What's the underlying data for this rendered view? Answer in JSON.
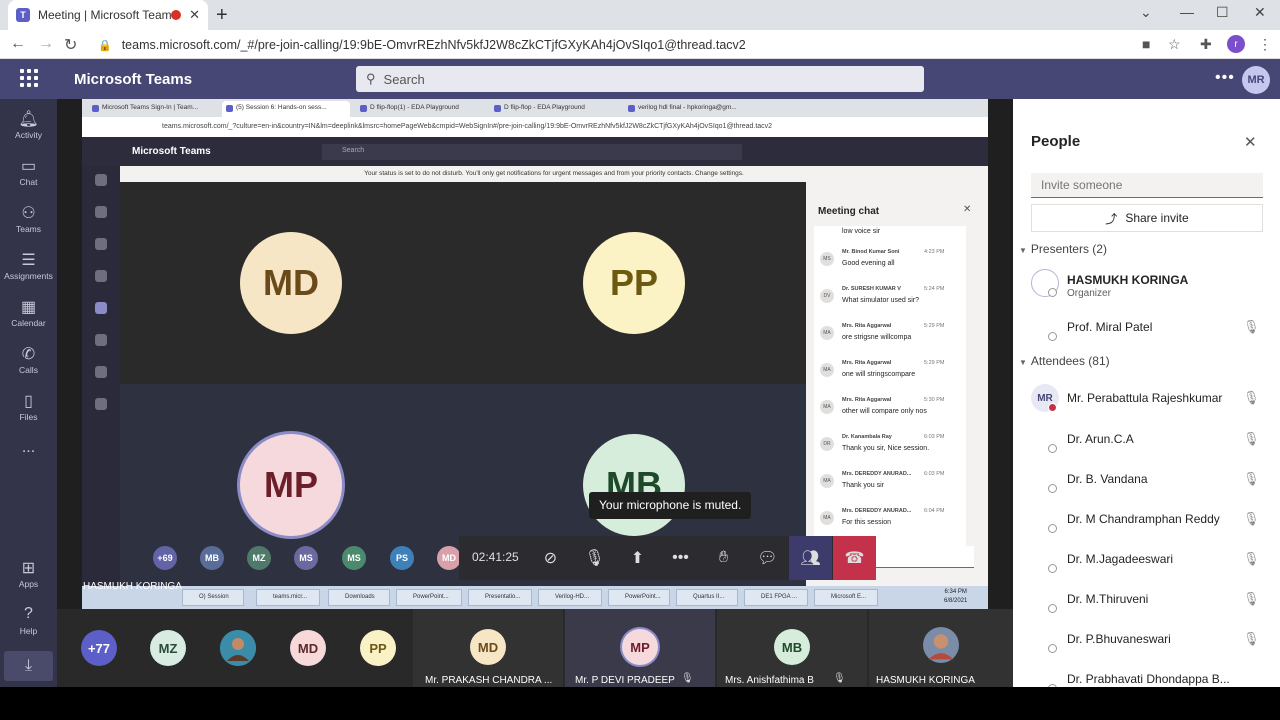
{
  "browser": {
    "tab_title": "Meeting | Microsoft Teams",
    "tab_close": "✕",
    "new_tab": "+",
    "url": "teams.microsoft.com/_#/pre-join-calling/19:9bE-OmvrREzhNfv5kfJ2W8cZkCTjfGXyKAh4jOvSIqo1@thread.tacv2",
    "profile_initial": "r"
  },
  "teams": {
    "app_name": "Microsoft Teams",
    "search_placeholder": "Search",
    "user_initials": "MR"
  },
  "rail": [
    {
      "label": "Activity",
      "icon": "bell-icon"
    },
    {
      "label": "Chat",
      "icon": "chat-icon"
    },
    {
      "label": "Teams",
      "icon": "teams-icon"
    },
    {
      "label": "Assignments",
      "icon": "assignments-icon"
    },
    {
      "label": "Calendar",
      "icon": "calendar-icon"
    },
    {
      "label": "Calls",
      "icon": "phone-icon"
    },
    {
      "label": "Files",
      "icon": "files-icon"
    },
    {
      "label": "...",
      "icon": "more-icon"
    },
    {
      "label": "Apps",
      "icon": "apps-icon"
    },
    {
      "label": "Help",
      "icon": "help-icon"
    }
  ],
  "shared_screen": {
    "tabs": [
      "Microsoft Teams Sign-In | Team...",
      "(5) Session 6: Hands-on sess...",
      "D flip-flop(1) - EDA Playground",
      "D flip-flop - EDA Playground",
      "verilog hdl final - hpkoringa@gm..."
    ],
    "url": "teams.microsoft.com/_?culture=en-in&country=IN&lm=deeplink&lmsrc=homePageWeb&cmpid=WebSignIn#/pre-join-calling/19:9bE-OmvrREzhNfv5kfJ2W8cZkCTjfGXyKAh4jOvSIqo1@thread.tacv2",
    "app_name": "Microsoft Teams",
    "search": "Search",
    "status_banner": "Your status is set to do not disturb. You'll only get notifications for urgent messages and from your priority contacts. Change settings.",
    "tiles": [
      {
        "initials": "MD",
        "bg": "#f6e6c6",
        "fg": "#6b4a1a"
      },
      {
        "initials": "PP",
        "bg": "#fbf3c6",
        "fg": "#6b5a10"
      },
      {
        "initials": "MP",
        "bg": "#f6d9dd",
        "fg": "#6b1f2a"
      },
      {
        "initials": "MB",
        "bg": "#d6eddc",
        "fg": "#1f4a2a"
      }
    ],
    "chat": {
      "title": "Meeting chat",
      "messages": [
        {
          "initials": "",
          "name": "",
          "time": "",
          "text": "low voice sir"
        },
        {
          "initials": "MS",
          "name": "Mr. Binod Kumar Soni",
          "time": "4:23 PM",
          "text": "Good evening all"
        },
        {
          "initials": "DV",
          "name": "Dr. SURESH KUMAR V",
          "time": "5:24 PM",
          "text": "What simulator used sir?"
        },
        {
          "initials": "MA",
          "name": "Mrs. Rita Aggarwal",
          "time": "5:29 PM",
          "text": "ore strigsne willcompa"
        },
        {
          "initials": "MA",
          "name": "Mrs. Rita Aggarwal",
          "time": "5:29 PM",
          "text": "one will stringscompare"
        },
        {
          "initials": "MA",
          "name": "Mrs. Rita Aggarwal",
          "time": "5:30 PM",
          "text": "other will compare only nos"
        },
        {
          "initials": "DR",
          "name": "Dr. Kanambala Ray",
          "time": "6:03 PM",
          "text": "Thank you sir, Nice session."
        },
        {
          "initials": "MA",
          "name": "Mrs. DEREDDY ANURAD...",
          "time": "6:03 PM",
          "text": "Thank you sir"
        },
        {
          "initials": "MA",
          "name": "Mrs. DEREDDY ANURAD...",
          "time": "6:04 PM",
          "text": "For this session"
        }
      ]
    },
    "taskbar": [
      "O) Session",
      "teams.micr...",
      "Downloads",
      "PowerPoint...",
      "Presentatio...",
      "Verilog-HD...",
      "PowerPoint...",
      "Quartus II...",
      "DE1 FPGA ...",
      "Microsoft E..."
    ],
    "clock_time": "6:34 PM",
    "clock_date": "6/8/2021"
  },
  "toast": "Your microphone is muted.",
  "roster_bubbles": [
    {
      "label": "+69",
      "bg": "#6264a7"
    },
    {
      "label": "MB",
      "bg": "#5a6d9a"
    },
    {
      "label": "MZ",
      "bg": "#4f7a6a"
    },
    {
      "label": "MS",
      "bg": "#6a6aa0"
    },
    {
      "label": "MS",
      "bg": "#4c8a6e"
    },
    {
      "label": "PS",
      "bg": "#3f80b8"
    },
    {
      "label": "MD",
      "bg": "#d8a0a8"
    }
  ],
  "controls": {
    "timer": "02:41:25",
    "icons": [
      "camera-off-icon",
      "mic-off-icon",
      "share-icon",
      "more-icon",
      "raise-hand-icon",
      "chat-icon",
      "people-icon",
      "hang-up-icon"
    ]
  },
  "presenter_name": "HASMUKH KORINGA",
  "bottom_strip": [
    {
      "initials": "+77",
      "name": "",
      "bg": "#5b5fc7",
      "fg": "#ffffff"
    },
    {
      "initials": "MZ",
      "name": "",
      "bg": "#d8ece2",
      "fg": "#2a4a3a"
    },
    {
      "initials": "",
      "name": "",
      "bg": "#3a8ca8",
      "fg": "#ffffff"
    },
    {
      "initials": "MD",
      "name": "",
      "bg": "#f7d9d9",
      "fg": "#5a2a2a"
    },
    {
      "initials": "PP",
      "name": "",
      "bg": "#fbf1c7",
      "fg": "#6b5a10"
    },
    {
      "initials": "MD",
      "name": "Mr. PRAKASH CHANDRA ...",
      "bg": "#f6e6c6",
      "fg": "#6b4a1a"
    },
    {
      "initials": "MP",
      "name": "Mr. P DEVI PRADEEP",
      "bg": "#f6d9dd",
      "fg": "#6b1f2a"
    },
    {
      "initials": "MB",
      "name": "Mrs. Anishfathima B",
      "bg": "#d6eddc",
      "fg": "#1f4a2a"
    },
    {
      "initials": "",
      "name": "HASMUKH KORINGA",
      "bg": "#c9906e",
      "fg": "#ffffff"
    }
  ],
  "people": {
    "title": "People",
    "invite_placeholder": "Invite someone",
    "share_invite": "Share invite",
    "presenters_header": "Presenters (2)",
    "attendees_header": "Attendees (81)",
    "presenters": [
      {
        "name": "HASMUKH KORINGA",
        "sub": "Organizer",
        "initials": ""
      },
      {
        "name": "Prof. Miral Patel",
        "sub": "",
        "initials": ""
      }
    ],
    "attendees": [
      {
        "name": "Mr. Perabattula Rajeshkumar",
        "initials": "MR"
      },
      {
        "name": "Dr. Arun.C.A",
        "initials": ""
      },
      {
        "name": "Dr. B. Vandana",
        "initials": ""
      },
      {
        "name": "Dr. M Chandramphan Reddy",
        "initials": ""
      },
      {
        "name": "Dr. M.Jagadeeswari",
        "initials": ""
      },
      {
        "name": "Dr. M.Thiruveni",
        "initials": ""
      },
      {
        "name": "Dr. P.Bhuvaneswari",
        "initials": ""
      },
      {
        "name": "Dr. Prabhavati Dhondappa B...",
        "initials": ""
      }
    ]
  }
}
